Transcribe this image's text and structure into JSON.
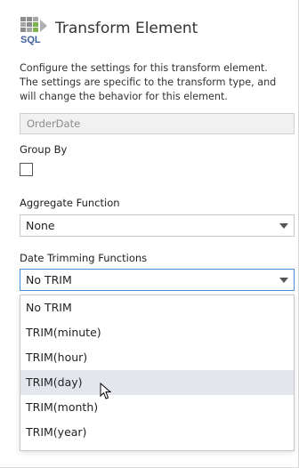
{
  "header": {
    "title": "Transform Element",
    "logo_text": "SQL",
    "logo_colors": {
      "grid": "#8c8c8c",
      "green": "#7fb24a",
      "sql_text": "#3d5e9c"
    }
  },
  "description": "Configure the settings for this transform element. The settings are specific to the transform type, and will change the behavior for this element.",
  "field": {
    "value": "OrderDate"
  },
  "group_by": {
    "label": "Group By",
    "checked": false
  },
  "aggregate": {
    "label": "Aggregate Function",
    "selected": "None"
  },
  "date_trim": {
    "label": "Date Trimming Functions",
    "selected": "No TRIM",
    "options": [
      "No TRIM",
      "TRIM(minute)",
      "TRIM(hour)",
      "TRIM(day)",
      "TRIM(month)",
      "TRIM(year)"
    ],
    "hovered_option": "TRIM(day)"
  },
  "colors": {
    "focus_border": "#4a90d9",
    "hover_bg": "#e4e6ee",
    "readonly_bg": "#f1f1f1"
  }
}
